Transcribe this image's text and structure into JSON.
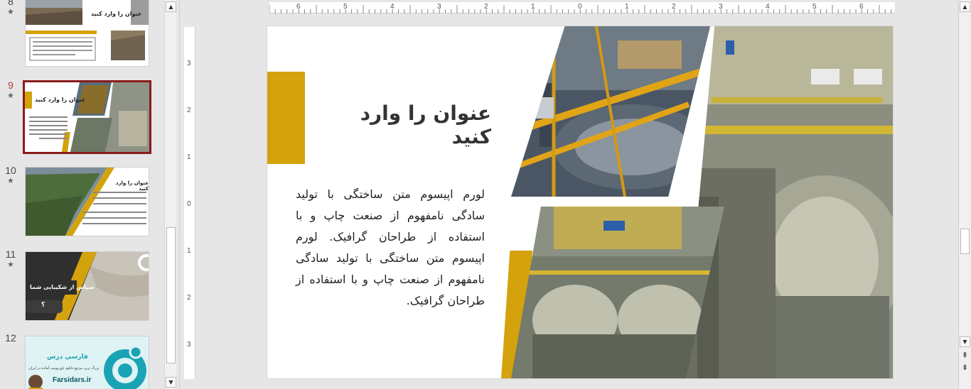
{
  "colors": {
    "accent": "#d4a20d",
    "selected_border": "#8a1c1c",
    "active_number": "#c0392b"
  },
  "thumbnails": [
    {
      "number": "8",
      "star": "★",
      "title": "عنوان را وارد کنید"
    },
    {
      "number": "9",
      "star": "★",
      "title": "عنوان را وارد کنید",
      "selected": true
    },
    {
      "number": "10",
      "star": "★",
      "title": "عنوان را وارد کنید"
    },
    {
      "number": "11",
      "star": "★",
      "title": "سپاس از شکیبایی شما",
      "subtitle": "؟"
    },
    {
      "number": "12",
      "brand": "فارسی درس",
      "tagline": "بزرگ ترین مرجع دانلود پاورپوینت آماده در ایران",
      "site": "Farsidars.ir"
    }
  ],
  "ruler": {
    "horizontal_numbers": [
      "6",
      "5",
      "4",
      "3",
      "2",
      "1",
      "0",
      "1",
      "2",
      "3",
      "4",
      "5",
      "6"
    ],
    "vertical_numbers": [
      "3",
      "2",
      "1",
      "0",
      "1",
      "2",
      "3"
    ]
  },
  "slide": {
    "title": "عنوان را وارد کنید",
    "body": "لورم اپیسوم متن ساختگی با تولید سادگی نامفهوم از صنعت چاپ و با استفاده از طراحان گرافیک. لورم اپیسوم متن ساختگی با تولید سادگی نامفهوم از صنعت چاپ و با استفاده از طراحان گرافیک."
  },
  "icons": {
    "scroll_up": "▲",
    "scroll_down": "▼",
    "prev_slide": "⇞",
    "next_slide": "⇟"
  }
}
